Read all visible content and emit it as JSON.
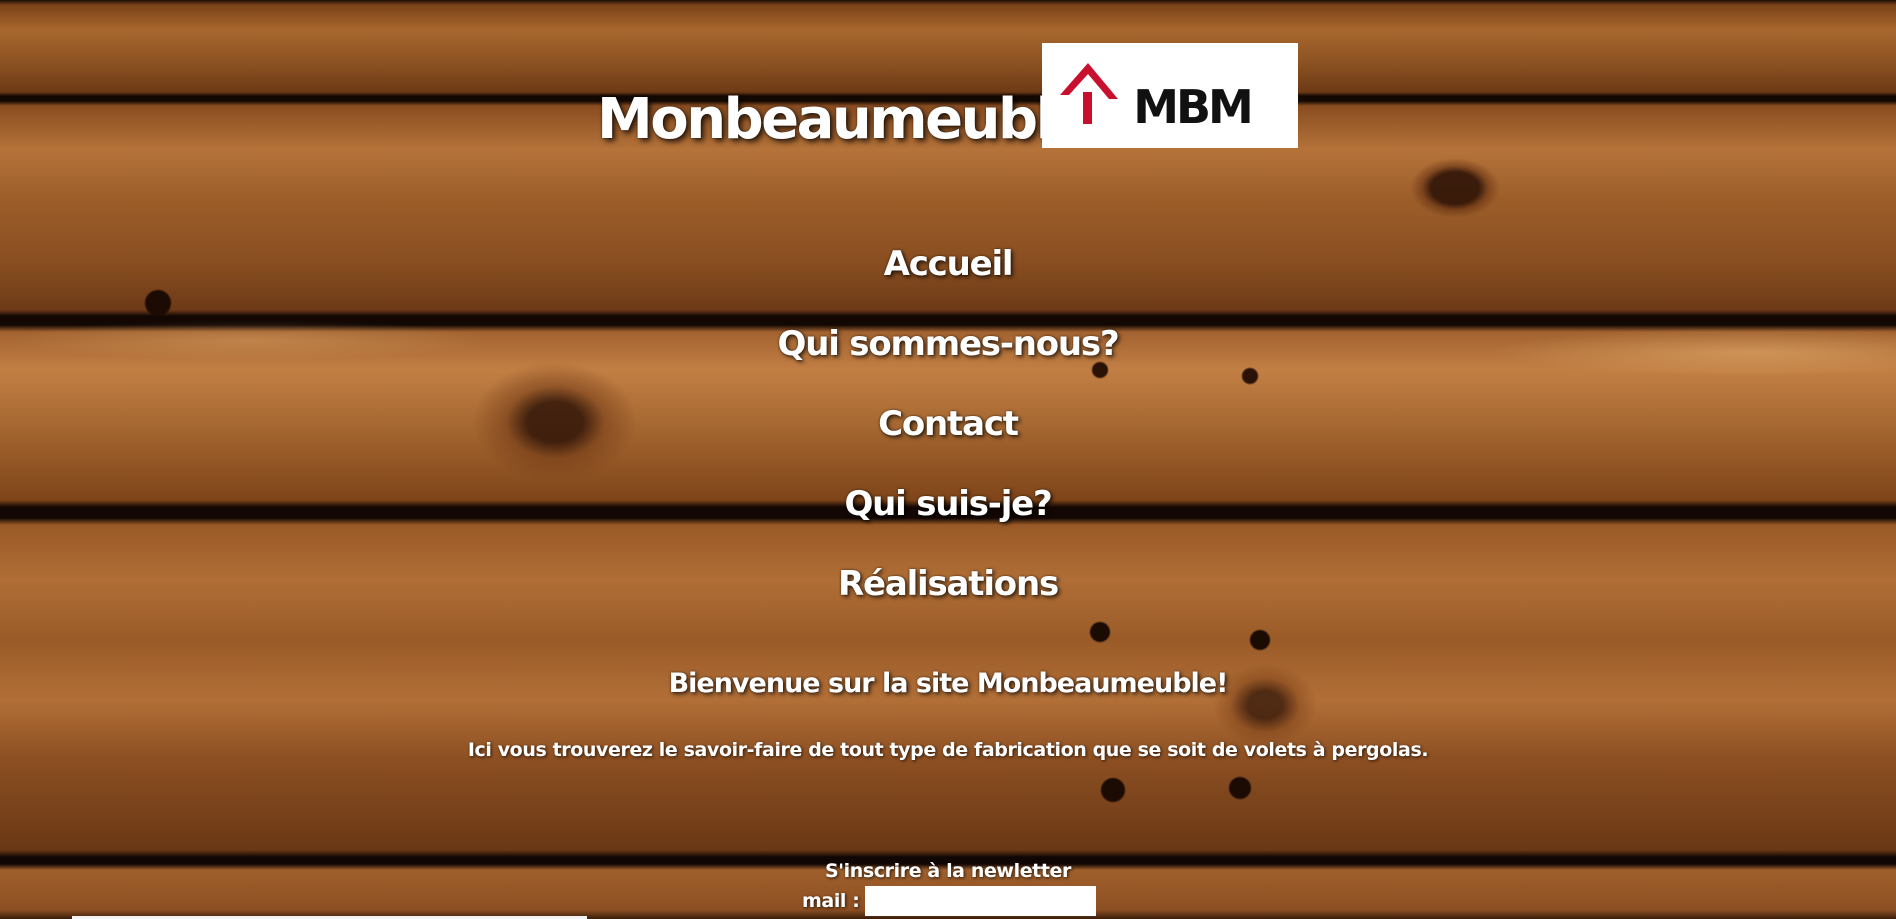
{
  "header": {
    "site_title": "Monbeaumeuble",
    "logo": {
      "icon": "mbm-house-roof-logo",
      "text": "MBM",
      "roof_color": "#c8102e",
      "text_color": "#111111",
      "background": "#ffffff"
    }
  },
  "nav": {
    "items": [
      {
        "label": "Accueil"
      },
      {
        "label": "Qui sommes-nous?"
      },
      {
        "label": "Contact"
      },
      {
        "label": "Qui suis-je?"
      },
      {
        "label": "Réalisations"
      }
    ]
  },
  "main": {
    "welcome_heading": "Bienvenue sur la site Monbeaumeuble!",
    "intro_text": "Ici vous trouverez le savoir-faire de tout type de fabrication que se soit de volets à pergolas."
  },
  "newsletter": {
    "title": "S'inscrire à la newletter",
    "mail_label": "mail :",
    "mail_value": "",
    "mail_placeholder": ""
  },
  "theme": {
    "background": "wood-planks",
    "text_color": "#ffffff"
  }
}
